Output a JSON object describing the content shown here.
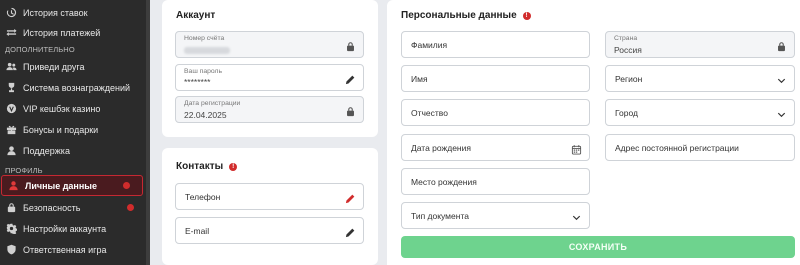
{
  "sidebar": {
    "items_top": [
      {
        "label": "История ставок",
        "icon": "history-icon"
      },
      {
        "label": "История платежей",
        "icon": "payments-history-icon"
      }
    ],
    "section_extra": "ДОПОЛНИТЕЛЬНО",
    "items_extra": [
      {
        "label": "Приведи друга",
        "icon": "users-icon"
      },
      {
        "label": "Система вознаграждений",
        "icon": "rewards-icon"
      },
      {
        "label": "VIP кешбэк казино",
        "icon": "vip-cashback-icon"
      },
      {
        "label": "Бонусы и подарки",
        "icon": "gift-icon"
      },
      {
        "label": "Поддержка",
        "icon": "support-icon"
      }
    ],
    "section_profile": "ПРОФИЛЬ",
    "items_profile": [
      {
        "label": "Личные данные",
        "icon": "user-icon"
      },
      {
        "label": "Безопасность",
        "icon": "lock-icon"
      },
      {
        "label": "Настройки аккаунта",
        "icon": "gear-icon"
      },
      {
        "label": "Ответственная игра",
        "icon": "shield-icon"
      }
    ]
  },
  "account": {
    "title": "Аккаунт",
    "account_number_label": "Номер счёта",
    "password_label": "Ваш пароль",
    "password_value": "********",
    "reg_date_label": "Дата регистрации",
    "reg_date_value": "22.04.2025"
  },
  "contacts": {
    "title": "Контакты",
    "phone_placeholder": "Телефон",
    "email_placeholder": "E-mail"
  },
  "personal": {
    "title": "Персональные данные",
    "last_name": "Фамилия",
    "first_name": "Имя",
    "patronymic": "Отчество",
    "birth_date": "Дата рождения",
    "birth_place": "Место рождения",
    "document_type": "Тип документа",
    "country_label": "Страна",
    "country_value": "Россия",
    "region": "Регион",
    "city": "Город",
    "address": "Адрес постоянной регистрации",
    "save_label": "СОХРАНИТЬ"
  },
  "colors": {
    "accent": "#c62832",
    "save": "#6ed38e",
    "sidebar": "#2b2b2b"
  }
}
